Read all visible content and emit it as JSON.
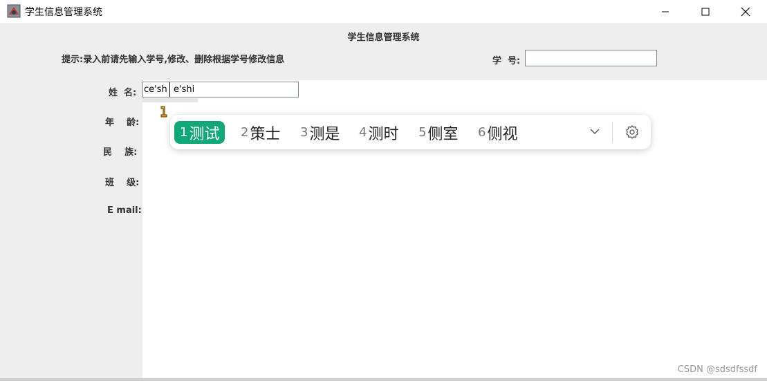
{
  "window": {
    "title": "学生信息管理系统"
  },
  "panel": {
    "heading": "学生信息管理系统",
    "hint": "提示:录入前请先输入学号,修改、删除根据学号修改信息",
    "id_label": "学  号:",
    "id_value": ""
  },
  "form": {
    "name_label": "姓  名:",
    "name_value": "ce'shi",
    "name_composition": "e'shi",
    "age_label": "年    龄:",
    "ethnicity_label": "民    族:",
    "class_label": "班    级:",
    "email_label": "E mail:"
  },
  "ime": {
    "candidates": [
      {
        "num": "1",
        "word": "测试",
        "selected": true
      },
      {
        "num": "2",
        "word": "策士"
      },
      {
        "num": "3",
        "word": "测是"
      },
      {
        "num": "4",
        "word": "测时"
      },
      {
        "num": "5",
        "word": "侧室"
      },
      {
        "num": "6",
        "word": "侧视"
      }
    ],
    "accent": "#10a877"
  },
  "footer": {
    "watermark": "CSDN @sdsdfssdf"
  }
}
